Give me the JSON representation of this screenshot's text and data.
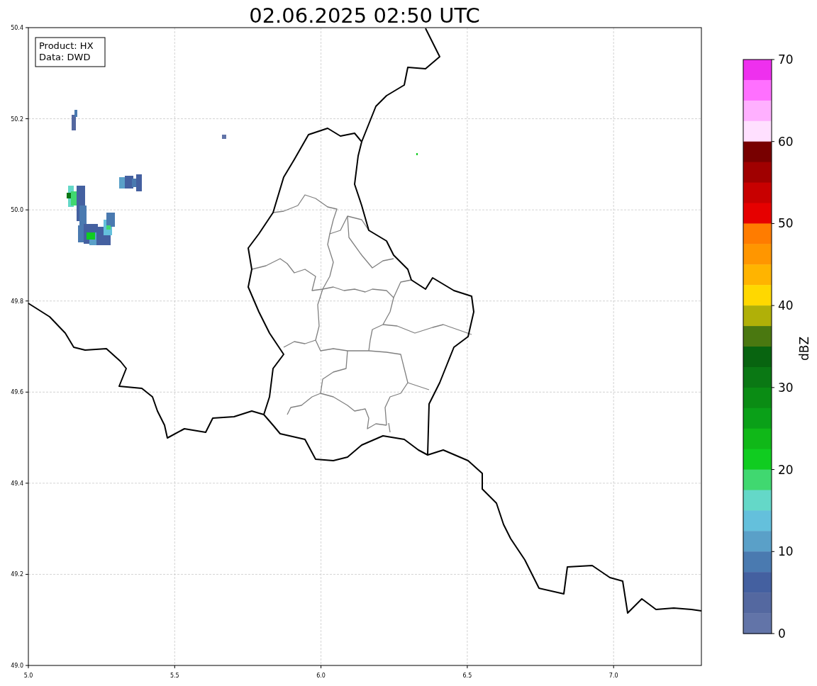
{
  "title": "02.06.2025 02:50 UTC",
  "info_box": {
    "lines": [
      "Product: HX",
      "Data: DWD"
    ]
  },
  "x_ticks": [
    "5.0",
    "5.5",
    "6.0",
    "6.5",
    "7.0"
  ],
  "y_ticks": [
    "50.4",
    "50.2",
    "50.0",
    "49.8",
    "49.6",
    "49.4",
    "49.2",
    "49.0"
  ],
  "colorbar": {
    "label": "dBZ",
    "ticks": [
      "70",
      "60",
      "50",
      "40",
      "30",
      "20",
      "10",
      "0"
    ],
    "bins": [
      {
        "color": "#ee30ee"
      },
      {
        "color": "#ff70ff"
      },
      {
        "color": "#ffb0ff"
      },
      {
        "color": "#ffe0ff"
      },
      {
        "color": "#780000"
      },
      {
        "color": "#a00000"
      },
      {
        "color": "#c80000"
      },
      {
        "color": "#e60000"
      },
      {
        "color": "#ff7c00"
      },
      {
        "color": "#ff9600"
      },
      {
        "color": "#ffb400"
      },
      {
        "color": "#ffd800"
      },
      {
        "color": "#b0b008"
      },
      {
        "color": "#4a7810"
      },
      {
        "color": "#086410"
      },
      {
        "color": "#0a7814"
      },
      {
        "color": "#0a8c14"
      },
      {
        "color": "#0aa018"
      },
      {
        "color": "#10b818"
      },
      {
        "color": "#10cc20"
      },
      {
        "color": "#40d870"
      },
      {
        "color": "#64d8c8"
      },
      {
        "color": "#64c0dc"
      },
      {
        "color": "#5aa0c8"
      },
      {
        "color": "#4a7ab0"
      },
      {
        "color": "#4460a0"
      },
      {
        "color": "#5468a0"
      },
      {
        "color": "#6274a8"
      }
    ]
  }
}
